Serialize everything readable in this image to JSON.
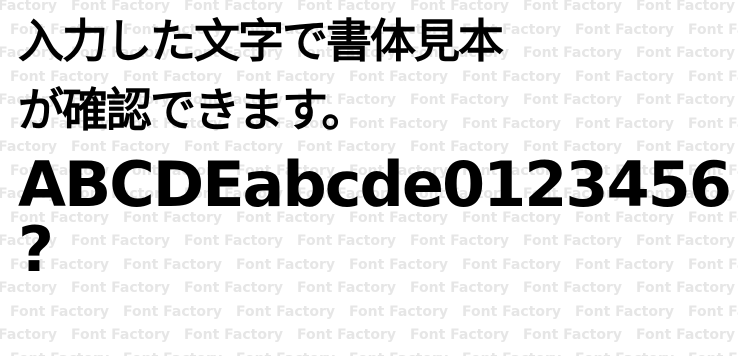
{
  "watermark": {
    "text": "Font Factory",
    "color": "#e6e6e6"
  },
  "sample": {
    "line1": "入力した文字で書体見本",
    "line2": "が確認できます。",
    "line3": "ABCDEabcde0123456",
    "line4": "?"
  }
}
